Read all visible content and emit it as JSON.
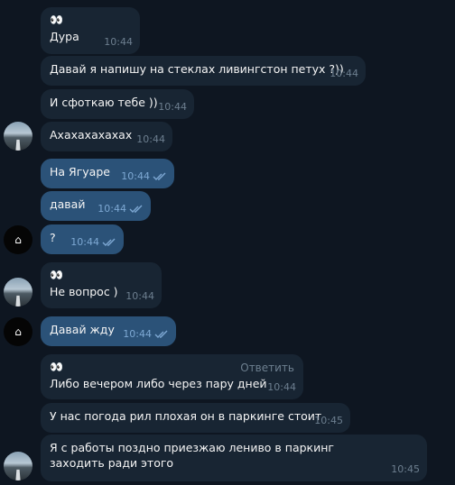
{
  "messages": [
    {
      "emoji": "👀",
      "text": "Дура",
      "time": "10:44"
    },
    {
      "text": "Давай я напишу на стеклах ливингстон петух ?))",
      "time": "10:44"
    },
    {
      "text": "И сфоткаю тебе ))",
      "time": "10:44"
    },
    {
      "text": "Ахахахахахах",
      "time": "10:44"
    },
    {
      "text": "На Ягуаре",
      "time": "10:44"
    },
    {
      "text": "давай",
      "time": "10:44"
    },
    {
      "text": "?",
      "time": "10:44"
    },
    {
      "emoji": "👀",
      "text": "Не вопрос )",
      "time": "10:44"
    },
    {
      "text": "Давай жду",
      "time": "10:44"
    },
    {
      "emoji": "👀",
      "reply_label": "Ответить",
      "text": "Либо вечером либо через пару дней",
      "time": "10:44"
    },
    {
      "text": "У нас погода рил плохая он в паркинге стоит",
      "time": "10:45"
    },
    {
      "text": "Я с работы поздно приезжаю лениво в паркинг заходить ради этого",
      "time": "10:45"
    }
  ],
  "colors": {
    "background": "#0e1621",
    "incoming_bubble": "#182533",
    "outgoing_bubble": "#2b5278",
    "read_checks": "#7da8d3"
  },
  "icons": {
    "read_receipt": "double-check-icon",
    "avatar_partner": "road-landscape-avatar",
    "avatar_self": "house-logo-avatar"
  }
}
